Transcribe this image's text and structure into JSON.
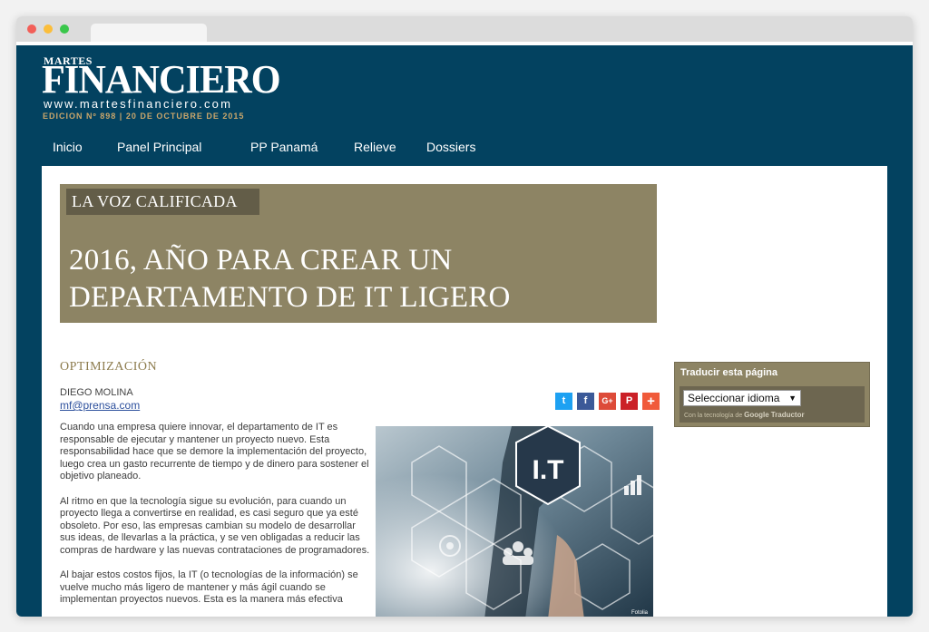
{
  "masthead": {
    "top_word": "MARTES",
    "brand": "FINANCIERO",
    "url": "www.martesfinanciero.com",
    "edition": "EDICION Nº 898 | 20 DE OCTUBRE DE 2015"
  },
  "nav": {
    "items": [
      {
        "label": "Inicio"
      },
      {
        "label": "Panel Principal"
      },
      {
        "label": "PP Panamá"
      },
      {
        "label": "Relieve"
      },
      {
        "label": "Dossiers"
      }
    ]
  },
  "article": {
    "kicker": "LA VOZ CALIFICADA",
    "title": "2016, AÑO PARA CREAR UN DEPARTAMENTO DE IT LIGERO",
    "section": "OPTIMIZACIÓN",
    "author": "DIEGO MOLINA",
    "email": "mf@prensa.com",
    "paragraphs": [
      "Cuando una empresa quiere innovar, el departamento de IT es responsable de ejecutar y mantener un proyecto nuevo. Esta responsabilidad  hace que se demore la implementación del proyecto, luego  crea un gasto recurrente de tiempo y de dinero para  sostener el objetivo planeado.",
      "Al ritmo en que la tecnología sigue su evolución, para cuando un proyecto llega a convertirse en realidad,  es casi seguro que ya esté  obsoleto. Por eso, las empresas  cambian su modelo de desarrollar sus ideas, de llevarlas a la práctica, y se ven obligadas a reducir las compras de hardware y las nuevas contrataciones de programadores.",
      "Al bajar estos costos fijos, la IT (o tecnologías de la información) se vuelve mucho más ligero de mantener y más ágil cuando se implementan proyectos nuevos. Esta es la manera más efectiva"
    ],
    "image": {
      "badge": "I.T",
      "credit": "Fotolia"
    }
  },
  "share": {
    "buttons": [
      {
        "name": "twitter",
        "glyph": "t"
      },
      {
        "name": "facebook",
        "glyph": "f"
      },
      {
        "name": "google-plus",
        "glyph": "G+"
      },
      {
        "name": "pinterest",
        "glyph": "P"
      },
      {
        "name": "more",
        "glyph": "+"
      }
    ]
  },
  "sidebar": {
    "translate_title": "Traducir esta página",
    "select_value": "Seleccionar idioma",
    "powered_prefix": "Con la tecnología de",
    "powered_google": "Google",
    "powered_suffix": "Traductor"
  },
  "colors": {
    "header_bg": "#034260",
    "hero_bg": "#8d8464",
    "kicker_bg": "#635d48",
    "edition_gold": "#c9a66b"
  }
}
